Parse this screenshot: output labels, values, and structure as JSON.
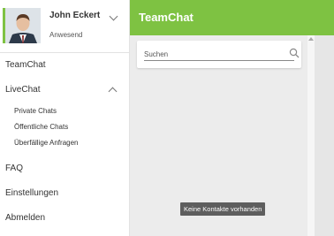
{
  "user": {
    "name": "John Eckert",
    "status": "Anwesend"
  },
  "nav": {
    "teamchat": "TeamChat",
    "livechat": "LiveChat",
    "livechat_items": [
      "Private Chats",
      "Öffentliche Chats",
      "Überfällige Anfragen"
    ],
    "faq": "FAQ",
    "settings": "Einstellungen",
    "logout": "Abmelden"
  },
  "app": {
    "title": "TeamChat"
  },
  "search": {
    "placeholder": "Suchen",
    "value": ""
  },
  "contacts": {
    "empty_message": "Keine Kontakte vorhanden"
  },
  "colors": {
    "accent": "#7ec242",
    "toast_bg": "#5e5e5e",
    "main_bg": "#ececec"
  },
  "icons": {
    "user_menu": "chevron-down-icon",
    "livechat_toggle": "chevron-up-icon",
    "search": "search-icon"
  }
}
